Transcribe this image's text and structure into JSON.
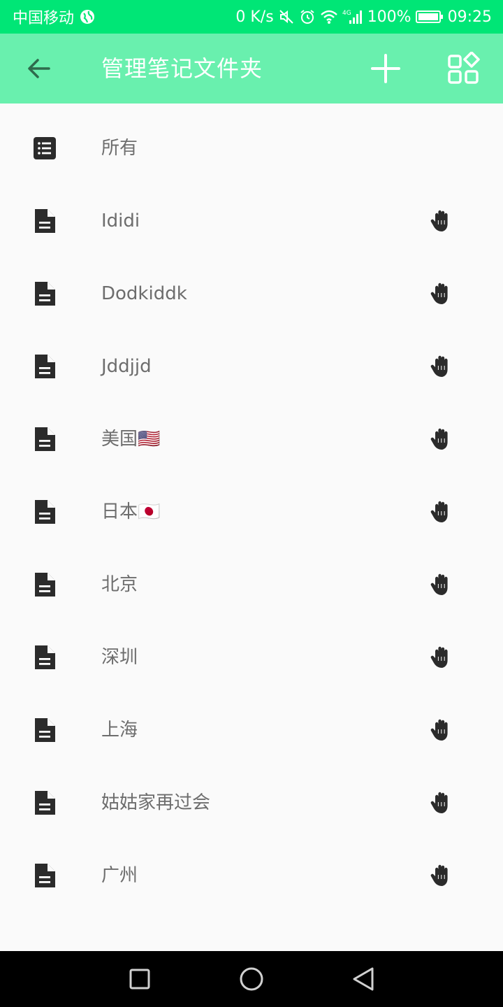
{
  "status_bar": {
    "carrier": "中国移动",
    "speed": "0 K/s",
    "network": "4G",
    "battery": "100%",
    "time": "09:25"
  },
  "toolbar": {
    "title": "管理笔记文件夹",
    "back_icon": "arrow-left-icon",
    "add_icon": "plus-icon",
    "grid_icon": "grid-diamond-icon"
  },
  "folders": [
    {
      "label": "所有",
      "icon": "list-icon",
      "draggable": false
    },
    {
      "label": "Ididi",
      "icon": "document-icon",
      "draggable": true
    },
    {
      "label": "Dodkiddk",
      "icon": "document-icon",
      "draggable": true
    },
    {
      "label": "Jddjjd",
      "icon": "document-icon",
      "draggable": true
    },
    {
      "label": "美国🇺🇸",
      "icon": "document-icon",
      "draggable": true
    },
    {
      "label": "日本🇯🇵",
      "icon": "document-icon",
      "draggable": true
    },
    {
      "label": "北京",
      "icon": "document-icon",
      "draggable": true
    },
    {
      "label": "深圳",
      "icon": "document-icon",
      "draggable": true
    },
    {
      "label": "上海",
      "icon": "document-icon",
      "draggable": true
    },
    {
      "label": "姑姑家再过会",
      "icon": "document-icon",
      "draggable": true
    },
    {
      "label": "广州",
      "icon": "document-icon",
      "draggable": true
    }
  ],
  "colors": {
    "status_bar": "#00e676",
    "toolbar": "#69f0ae",
    "background": "#fafafa",
    "icon": "#2b2b2b",
    "label": "#6d6d6d"
  }
}
